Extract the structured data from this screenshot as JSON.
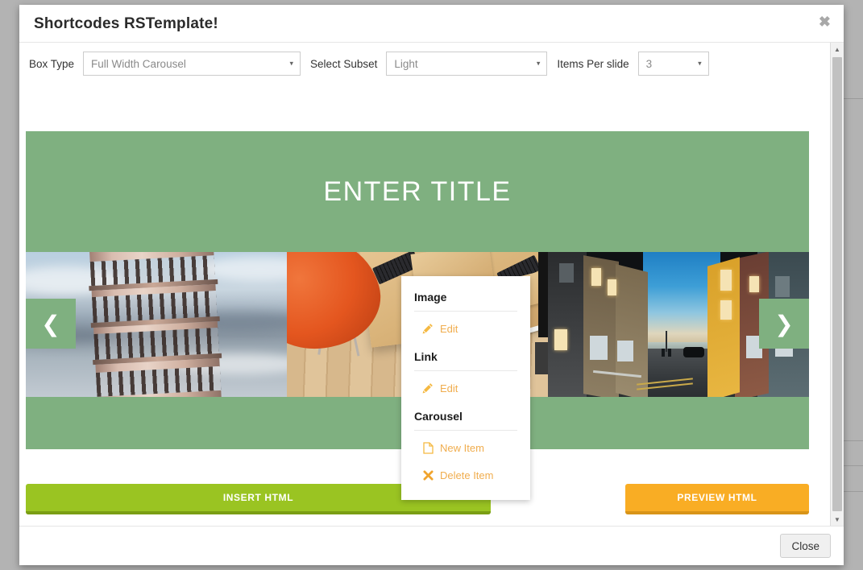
{
  "modal": {
    "title": "Shortcodes RSTemplate!",
    "close_x": "✖",
    "footer_close_label": "Close"
  },
  "toolbar": {
    "box_type_label": "Box Type",
    "box_type_value": "Full Width Carousel",
    "select_subset_label": "Select Subset",
    "select_subset_value": "Light",
    "items_per_slide_label": "Items Per slide",
    "items_per_slide_value": "3",
    "caret": "▾"
  },
  "carousel": {
    "title": "ENTER TITLE",
    "prev_arrow": "❮",
    "next_arrow": "❯",
    "background_color": "#7fb080",
    "slides": [
      {
        "alt": "leaning-tower-of-pisa"
      },
      {
        "alt": "orange-chair-wooden-desk"
      },
      {
        "alt": "narrow-street-at-dusk"
      }
    ]
  },
  "actions": {
    "insert_html_label": "INSERT HTML",
    "insert_html_color": "#9ac422",
    "preview_html_label": "PREVIEW HTML",
    "preview_html_color": "#f9ad24"
  },
  "context_menu": {
    "accent_color": "#f0ad4e",
    "sections": [
      {
        "heading": "Image",
        "items": [
          {
            "label": "Edit",
            "icon": "pencil-icon"
          }
        ]
      },
      {
        "heading": "Link",
        "items": [
          {
            "label": "Edit",
            "icon": "pencil-icon"
          }
        ]
      },
      {
        "heading": "Carousel",
        "items": [
          {
            "label": "New Item",
            "icon": "file-icon"
          },
          {
            "label": "Delete Item",
            "icon": "times-icon"
          }
        ]
      }
    ]
  },
  "scrollbar": {
    "up_arrow": "▲",
    "down_arrow": "▼"
  }
}
